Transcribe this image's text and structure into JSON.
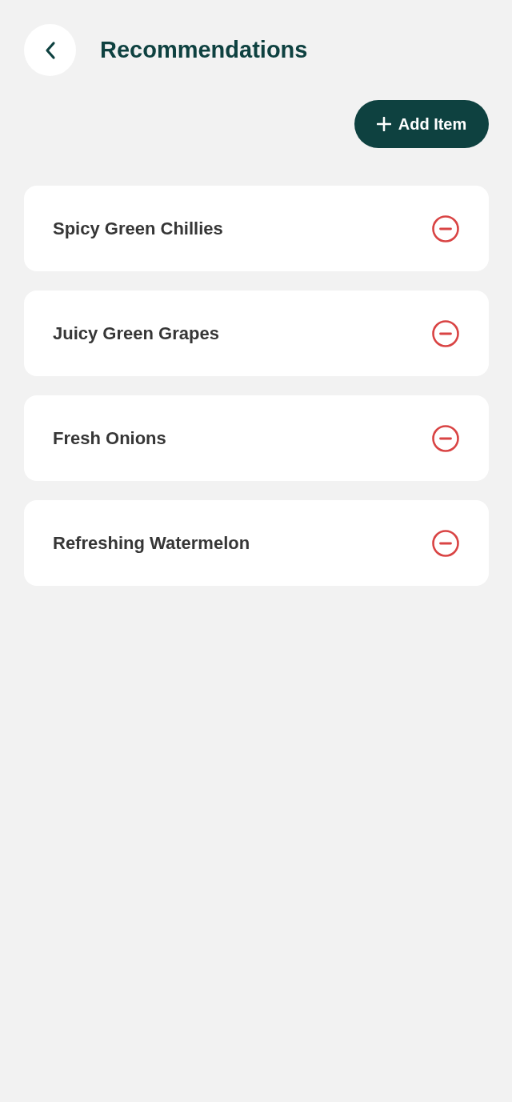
{
  "header": {
    "title": "Recommendations"
  },
  "add_button": {
    "label": "Add Item"
  },
  "items": [
    {
      "name": "Spicy Green Chillies"
    },
    {
      "name": "Juicy Green Grapes"
    },
    {
      "name": "Fresh Onions"
    },
    {
      "name": "Refreshing Watermelon"
    }
  ]
}
